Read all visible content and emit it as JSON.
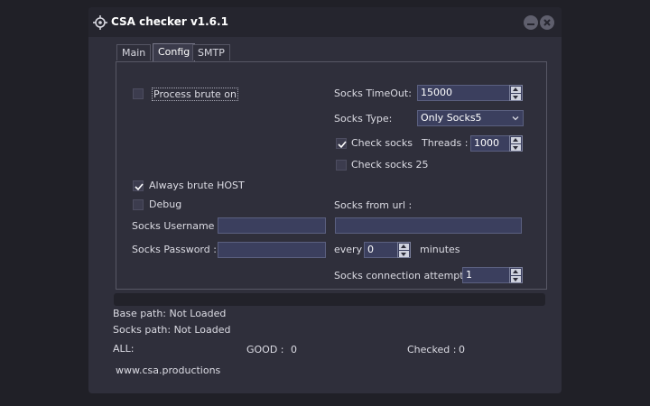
{
  "window": {
    "title": "CSA checker v1.6.1"
  },
  "tabs": [
    {
      "label": "Main",
      "active": false
    },
    {
      "label": "Config",
      "active": true
    },
    {
      "label": "SMTP",
      "active": false
    }
  ],
  "config": {
    "process_brute": {
      "label": "Process brute on",
      "checked": false
    },
    "always_brute_host": {
      "label": "Always brute HOST",
      "checked": true
    },
    "debug": {
      "label": "Debug",
      "checked": false
    },
    "socks_username": {
      "label": "Socks Username :",
      "value": ""
    },
    "socks_password": {
      "label": "Socks Password :",
      "value": ""
    },
    "socks_timeout": {
      "label": "Socks TimeOut:",
      "value": "15000"
    },
    "socks_type": {
      "label": "Socks Type:",
      "value": "Only Socks5"
    },
    "check_socks": {
      "label": "Check socks",
      "checked": true
    },
    "threads": {
      "label": "Threads :",
      "value": "1000"
    },
    "check_socks_25": {
      "label": "Check socks 25",
      "checked": false
    },
    "socks_from_url": {
      "label": "Socks from url :",
      "value": ""
    },
    "every": {
      "label": "every",
      "value": "0",
      "unit": "minutes"
    },
    "connection_attempts": {
      "label": "Socks connection attempts :",
      "value": "1"
    }
  },
  "progress": {
    "value": 0
  },
  "status": {
    "base_path": "Base path: Not Loaded",
    "socks_path": "Socks path: Not Loaded",
    "all_label": "ALL:",
    "good_label": "GOOD :",
    "good_value": "0",
    "checked_label": "Checked :",
    "checked_value": "0",
    "website": "www.csa.productions"
  },
  "colors": {
    "background": "#202027",
    "window": "#2f2f3b",
    "titlebar": "#25252e",
    "input": "#3b3f5e",
    "accent": "#5a6fd0"
  },
  "icons": {
    "app": "crosshair-icon",
    "minimize": "minimize-icon",
    "close": "close-icon",
    "check": "checkmark-icon",
    "dropdown": "chevron-down-icon"
  }
}
